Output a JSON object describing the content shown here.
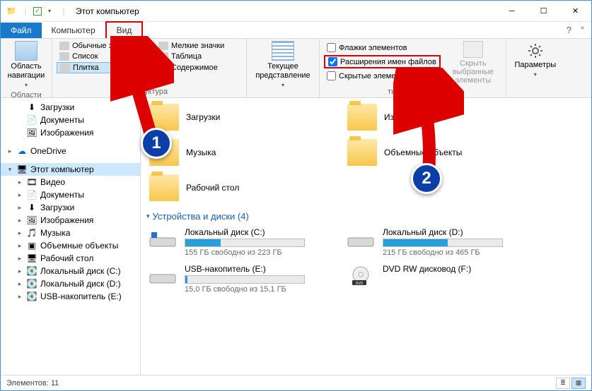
{
  "window": {
    "title": "Этот компьютер"
  },
  "tabs": {
    "file": "Файл",
    "computer": "Компьютер",
    "view": "Вид"
  },
  "ribbon": {
    "navpane": "Область навигации",
    "navpane_group": "Области",
    "layouts": {
      "normal_icons": "Обычные значки",
      "small_icons": "Мелкие значки",
      "list": "Список",
      "table": "Таблица",
      "tiles": "Плитка",
      "content": "Содержимое",
      "group": "Структура"
    },
    "current_view": "Текущее представление",
    "checks": {
      "item_checkboxes": "Флажки элементов",
      "file_extensions": "Расширения имен файлов",
      "hidden_items": "Скрытые элементы"
    },
    "hide_selected": "Скрыть выбранные элементы",
    "show_hide_group": "ть или скрыть",
    "parameters": "Параметры"
  },
  "tree": {
    "downloads": "Загрузки",
    "documents": "Документы",
    "pictures": "Изображения",
    "onedrive": "OneDrive",
    "this_pc": "Этот компьютер",
    "videos": "Видео",
    "music": "Музыка",
    "objects3d": "Объемные объекты",
    "desktop": "Рабочий стол",
    "local_c": "Локальный диск (C:)",
    "local_d": "Локальный диск (D:)",
    "usb_e": "USB-накопитель (E:)"
  },
  "folders": {
    "downloads": "Загрузки",
    "pictures": "Изображения",
    "music": "Музыка",
    "objects3d": "Объемные объекты",
    "desktop": "Рабочий стол"
  },
  "section_drives": "Устройства и диски (4)",
  "drives": {
    "c": {
      "name": "Локальный диск (C:)",
      "free": "155 ГБ свободно из 223 ГБ",
      "pct": 30
    },
    "d": {
      "name": "Локальный диск (D:)",
      "free": "215 ГБ свободно из 465 ГБ",
      "pct": 54
    },
    "e": {
      "name": "USB-накопитель (E:)",
      "free": "15,0 ГБ свободно из 15,1 ГБ",
      "pct": 2
    },
    "f": {
      "name": "DVD RW дисковод (F:)"
    }
  },
  "status": {
    "elements": "Элементов: 11"
  },
  "callouts": {
    "one": "1",
    "two": "2"
  }
}
